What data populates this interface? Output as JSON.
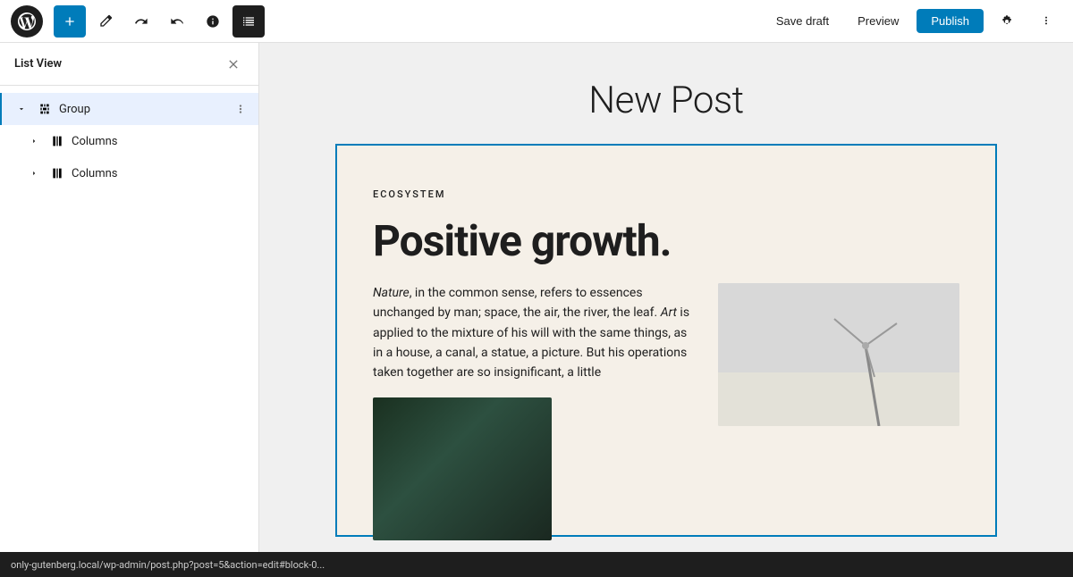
{
  "toolbar": {
    "add_label": "+",
    "save_draft_label": "Save draft",
    "preview_label": "Preview",
    "publish_label": "Publish"
  },
  "sidebar": {
    "title": "List View",
    "items": [
      {
        "id": "group",
        "label": "Group",
        "level": 0,
        "expanded": true,
        "selected": true
      },
      {
        "id": "columns-1",
        "label": "Columns",
        "level": 1,
        "expanded": false,
        "selected": false
      },
      {
        "id": "columns-2",
        "label": "Columns",
        "level": 1,
        "expanded": false,
        "selected": false
      }
    ]
  },
  "editor": {
    "post_title": "New Post",
    "content_blocks": [
      {
        "ecosystem_label": "ECOSYSTEM",
        "headline": "Positive growth.",
        "body_text_1": "Nature",
        "body_text_2": ", in the common sense, refers to essences unchanged by man; space, the air, the river, the leaf. ",
        "body_text_art": "Art",
        "body_text_3": " is applied to the mixture of his will with the same things, as in a house, a canal, a statue, a picture. But his operations taken together are so insignificant, a little"
      }
    ]
  },
  "status_bar": {
    "url": "only-gutenberg.local/wp-admin/post.php?post=5&action=edit#block-0..."
  },
  "icons": {
    "wp_logo": "wordpress-icon",
    "add": "plus-icon",
    "edit": "pencil-icon",
    "undo": "undo-icon",
    "redo": "redo-icon",
    "info": "info-icon",
    "list_view": "list-view-icon",
    "settings": "settings-icon",
    "more": "ellipsis-icon",
    "close": "close-icon",
    "chevron_right": "▶",
    "columns_block": "columns-block-icon",
    "group_block": "group-block-icon"
  }
}
